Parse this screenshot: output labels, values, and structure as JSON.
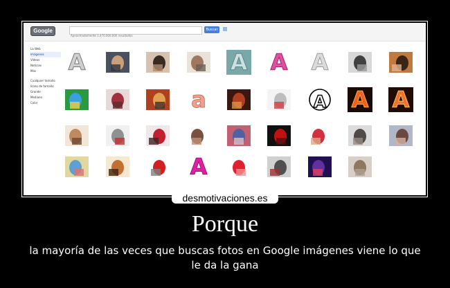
{
  "watermark": "desmotivaciones.es",
  "title": "Porque",
  "caption": "la mayoría de las veces que buscas fotos en Google imágenes viene lo que le da la gana",
  "screenshot": {
    "logo_text": "Google",
    "search_button": "Buscar",
    "results_text": "Aproximadamente 1.470.000.000 resultados",
    "sidebar_items": [
      "La Web",
      "Imágenes",
      "Vídeos",
      "Noticias",
      "Más"
    ],
    "sidebar_filters": [
      "Cualquier tamaño",
      "Icono de tamaño",
      "Grande",
      "Mediano",
      "Color"
    ],
    "thumbnails": [
      {
        "id": "letter-a-outline",
        "kind": "letter",
        "glyph": "A",
        "color": "#cfcfcf",
        "stroke": "#777",
        "bg": "#fff"
      },
      {
        "id": "person-photo",
        "kind": "photo",
        "colors": [
          "#4a5060",
          "#c8a07a",
          "#2e3440"
        ]
      },
      {
        "id": "woman-lying",
        "kind": "photo",
        "colors": [
          "#d7c2b0",
          "#3a2a22",
          "#b08a70"
        ]
      },
      {
        "id": "magazine-page",
        "kind": "photo",
        "colors": [
          "#e8e2d8",
          "#a07860",
          "#6a6058"
        ]
      },
      {
        "id": "letter-a-teal-box",
        "kind": "letter",
        "glyph": "A",
        "color": "#d0e0e0",
        "stroke": "#5a8a8a",
        "bg": "#7aa8a8"
      },
      {
        "id": "letter-a-pink",
        "kind": "letter",
        "glyph": "A",
        "color": "#e050a0",
        "stroke": "#a02070",
        "bg": "#fff"
      },
      {
        "id": "letter-a-grey",
        "kind": "letter",
        "glyph": "A",
        "color": "#dcdcdc",
        "stroke": "#999",
        "bg": "#fff"
      },
      {
        "id": "man-bw",
        "kind": "photo",
        "colors": [
          "#d8d8d8",
          "#404040",
          "#9a9a9a"
        ]
      },
      {
        "id": "woman-standing",
        "kind": "photo",
        "colors": [
          "#c07a40",
          "#3a2418",
          "#e0b090"
        ]
      },
      {
        "id": "cartoon-monster",
        "kind": "photo",
        "colors": [
          "#2a9a40",
          "#3aa0e0",
          "#e8d040"
        ]
      },
      {
        "id": "woman-pink",
        "kind": "photo",
        "colors": [
          "#e8d8d8",
          "#a03040",
          "#5a3030"
        ]
      },
      {
        "id": "group-poster",
        "kind": "photo",
        "colors": [
          "#b04020",
          "#e0a050",
          "#403030"
        ]
      },
      {
        "id": "letter-a-script",
        "kind": "letter",
        "glyph": "a",
        "color": "#f0a090",
        "stroke": "#d07060",
        "bg": "#fff"
      },
      {
        "id": "dark-scene",
        "kind": "photo",
        "colors": [
          "#3a1810",
          "#b04020",
          "#e09040"
        ]
      },
      {
        "id": "document-page",
        "kind": "photo",
        "colors": [
          "#f4f4f4",
          "#bdbdbd",
          "#d04040"
        ]
      },
      {
        "id": "anarchy-symbol",
        "kind": "letter",
        "glyph": "A",
        "color": "#000",
        "stroke": "#000",
        "bg": "#fff",
        "circle": true
      },
      {
        "id": "letter-a-fire-1",
        "kind": "letter",
        "glyph": "A",
        "color": "#f06020",
        "stroke": "#ffb040",
        "bg": "#1a0a04"
      },
      {
        "id": "letter-a-fire-2",
        "kind": "letter",
        "glyph": "A",
        "color": "#f07030",
        "stroke": "#ffc060",
        "bg": "#200c04"
      },
      {
        "id": "cake",
        "kind": "photo",
        "colors": [
          "#f2e6d8",
          "#c08a60",
          "#6a4a30"
        ]
      },
      {
        "id": "car-drawing",
        "kind": "photo",
        "colors": [
          "#f0f0f0",
          "#909090",
          "#c03030"
        ]
      },
      {
        "id": "woman-red-dress",
        "kind": "photo",
        "colors": [
          "#f0e8e8",
          "#c02030",
          "#402020"
        ]
      },
      {
        "id": "dancer",
        "kind": "photo",
        "colors": [
          "#ffffff",
          "#7a5040",
          "#c09070"
        ]
      },
      {
        "id": "group-photo",
        "kind": "photo",
        "colors": [
          "#c06070",
          "#5060a0",
          "#e0c0c0"
        ]
      },
      {
        "id": "red-rose",
        "kind": "photo",
        "colors": [
          "#101010",
          "#c01010",
          "#501010"
        ]
      },
      {
        "id": "woman-bikini",
        "kind": "photo",
        "colors": [
          "#ffffff",
          "#d03040",
          "#e0a888"
        ]
      },
      {
        "id": "people-row",
        "kind": "photo",
        "colors": [
          "#dcdcdc",
          "#504a48",
          "#9a8a80"
        ]
      },
      {
        "id": "couple-photo",
        "kind": "photo",
        "colors": [
          "#b0b8c8",
          "#6a4a40",
          "#d8b0a0"
        ]
      },
      {
        "id": "toy-animals",
        "kind": "photo",
        "colors": [
          "#e0d8a0",
          "#60a0d0",
          "#e07070"
        ]
      },
      {
        "id": "sunburst-poster",
        "kind": "photo",
        "colors": [
          "#f4e8d0",
          "#c07030",
          "#402010"
        ]
      },
      {
        "id": "cartoon-mouse",
        "kind": "photo",
        "colors": [
          "#ffffff",
          "#d02020",
          "#808080"
        ]
      },
      {
        "id": "letter-a-magenta",
        "kind": "letter",
        "glyph": "A",
        "color": "#e020a0",
        "stroke": "#a0107a",
        "bg": "#fff"
      },
      {
        "id": "heart-cartoon",
        "kind": "photo",
        "colors": [
          "#ffffff",
          "#e02030",
          "#f09090"
        ]
      },
      {
        "id": "person-grey",
        "kind": "photo",
        "colors": [
          "#d0d0d0",
          "#505050",
          "#a03030"
        ]
      },
      {
        "id": "night-scene",
        "kind": "photo",
        "colors": [
          "#201050",
          "#6030a0",
          "#e04060"
        ]
      },
      {
        "id": "faded-photo",
        "kind": "photo",
        "colors": [
          "#d8d0c8",
          "#907860",
          "#b0a090"
        ]
      }
    ]
  }
}
